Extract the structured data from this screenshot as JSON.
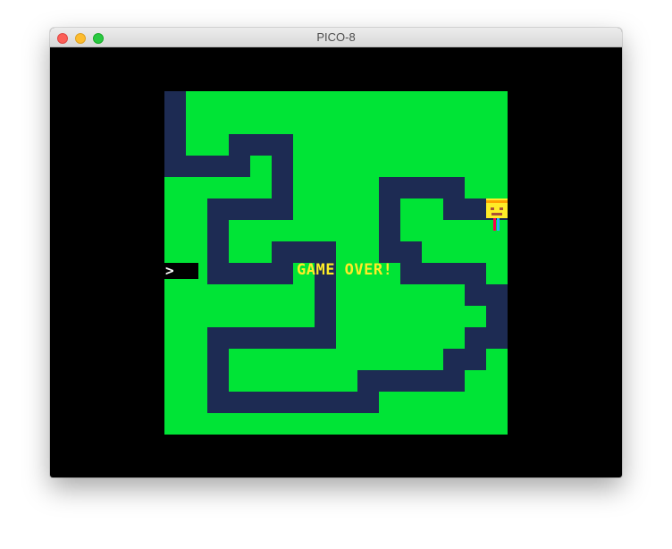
{
  "window": {
    "title": "PICO-8"
  },
  "game": {
    "status_text": "GAME OVER!",
    "exit_marker_glyph": ">",
    "colors": {
      "grass": "#00e436",
      "path": "#1d2b53",
      "text": "#ffec27",
      "background": "#000000"
    }
  }
}
